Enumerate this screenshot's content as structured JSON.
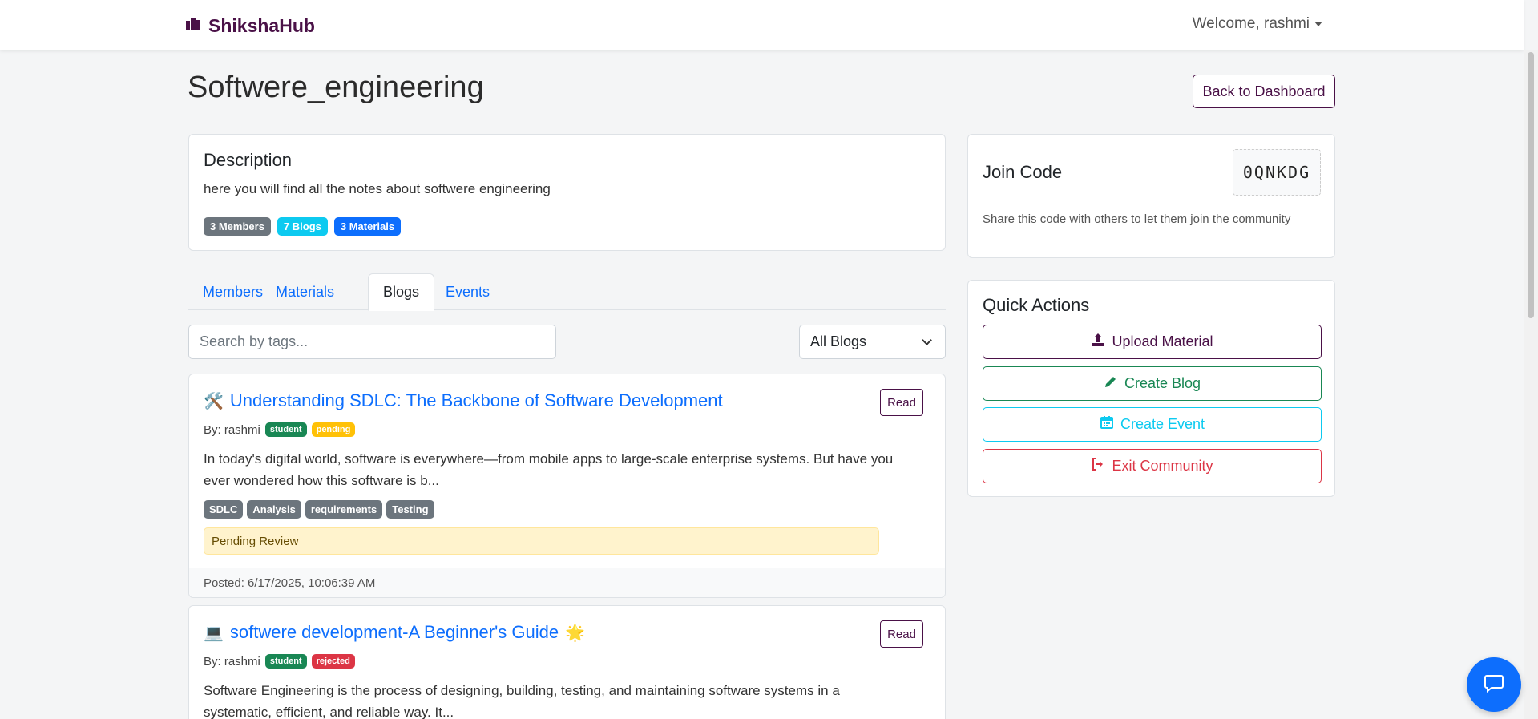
{
  "navbar": {
    "brand": "ShikshaHub",
    "welcome": "Welcome, rashmi"
  },
  "page": {
    "title": "Softwere_engineering",
    "back_button": "Back to Dashboard"
  },
  "description_card": {
    "heading": "Description",
    "text": "here you will find all the notes about softwere engineering",
    "badges": {
      "members": "3 Members",
      "blogs": "7 Blogs",
      "materials": "3 Materials"
    }
  },
  "tabs": {
    "members": "Members",
    "materials": "Materials",
    "blogs": "Blogs",
    "events": "Events",
    "active": "Blogs"
  },
  "filters": {
    "search_placeholder": "Search by tags...",
    "select_value": "All Blogs"
  },
  "blogs": [
    {
      "emoji": "🛠️",
      "title": "Understanding SDLC: The Backbone of Software Development",
      "read_label": "Read",
      "author": "By: rashmi",
      "role_badge": "student",
      "status_badge": "pending",
      "excerpt": "In today's digital world, software is everywhere—from mobile apps to large-scale enterprise systems. But have you ever wondered how this software is b...",
      "tags": [
        "SDLC",
        "Analysis",
        "requirements",
        "Testing"
      ],
      "notice": "Pending Review",
      "posted": "Posted: 6/17/2025, 10:06:39 AM"
    },
    {
      "emoji": "💻",
      "emoji_after": "🌟",
      "title": "softwere development-A Beginner's Guide",
      "read_label": "Read",
      "author": "By: rashmi",
      "role_badge": "student",
      "status_badge": "rejected",
      "excerpt": "Software Engineering is the process of designing, building, testing, and maintaining software systems in a systematic, efficient, and reliable way. It..."
    }
  ],
  "join_card": {
    "heading": "Join Code",
    "code": "0QNKDG",
    "hint": "Share this code with others to let them join the community"
  },
  "quick_actions": {
    "heading": "Quick Actions",
    "upload": "Upload Material",
    "create_blog": "Create Blog",
    "create_event": "Create Event",
    "exit": "Exit Community"
  },
  "colors": {
    "brand": "#4a1147",
    "link": "#0d6efd",
    "success": "#198754",
    "info": "#0dcaf0",
    "danger": "#dc3545",
    "warning": "#ffc107"
  },
  "icons": {
    "brand": "books-icon",
    "upload": "upload-icon",
    "blog": "pencil-icon",
    "event": "calendar-icon",
    "exit": "sign-out-icon",
    "chat": "chat-bubble-icon"
  }
}
